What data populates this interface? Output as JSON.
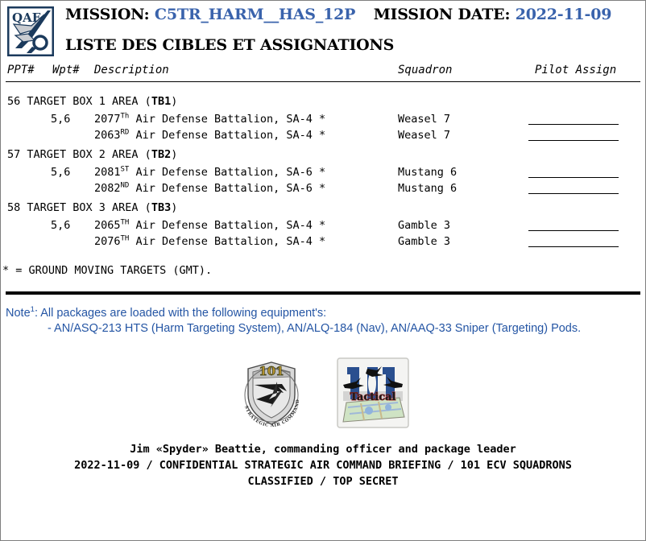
{
  "document": {
    "border_color": "#7f7f7f",
    "accent_blue": "#3a63ac",
    "note_blue": "#2455a4"
  },
  "header": {
    "logo_text": "QAF",
    "mission_label": "MISSION:",
    "mission_value": "C5TR_HARM__HAS_12P",
    "date_label": "MISSION DATE:",
    "date_value": "2022-11-09",
    "subtitle": "LISTE DES CIBLES ET ASSIGNATIONS"
  },
  "columns": {
    "ppt": "PPT#",
    "wpt": "Wpt#",
    "description": "Description",
    "squadron": "Squadron",
    "pilot_assign": "Pilot Assign"
  },
  "groups": [
    {
      "title_prefix": "56 TARGET BOX 1 AREA (",
      "title_code": "TB1",
      "title_suffix": ")",
      "rows": [
        {
          "wpt": "5,6",
          "unit_number": "2077",
          "unit_ordinal": "Th",
          "desc_rest": " Air Defense Battalion, SA-4 *",
          "squadron": "Weasel 7",
          "pilot_assign": ""
        },
        {
          "wpt": "",
          "unit_number": "2063",
          "unit_ordinal": "RD",
          "desc_rest": " Air Defense Battalion, SA-4 *",
          "squadron": "Weasel 7",
          "pilot_assign": ""
        }
      ]
    },
    {
      "title_prefix": "57 TARGET BOX 2 AREA (",
      "title_code": "TB2",
      "title_suffix": ")",
      "rows": [
        {
          "wpt": "5,6",
          "unit_number": "2081",
          "unit_ordinal": "ST",
          "desc_rest": " Air Defense Battalion, SA-6 *",
          "squadron": "Mustang 6",
          "pilot_assign": ""
        },
        {
          "wpt": "",
          "unit_number": "2082",
          "unit_ordinal": "ND",
          "desc_rest": " Air Defense Battalion, SA-6 *",
          "squadron": "Mustang 6",
          "pilot_assign": ""
        }
      ]
    },
    {
      "title_prefix": "58 TARGET BOX 3 AREA (",
      "title_code": "TB3",
      "title_suffix": ")",
      "rows": [
        {
          "wpt": "5,6",
          "unit_number": "2065",
          "unit_ordinal": "TH",
          "desc_rest": " Air Defense Battalion, SA-4 *",
          "squadron": "Gamble 3",
          "pilot_assign": ""
        },
        {
          "wpt": "",
          "unit_number": "2076",
          "unit_ordinal": "TH",
          "desc_rest": " Air Defense Battalion, SA-4 *",
          "squadron": "Gamble 3",
          "pilot_assign": ""
        }
      ]
    }
  ],
  "legend": {
    "gmt": "* = GROUND MOVING TARGETS (GMT)."
  },
  "note": {
    "label": "Note",
    "superscript": "1",
    "line1": ": All packages are loaded with the following equipment's:",
    "line2": "- AN/ASQ-213 HTS (Harm Targeting System), AN/ALQ-184 (Nav), AN/AAQ-33 Sniper (Targeting) Pods."
  },
  "emblems": {
    "sac": {
      "number": "101",
      "band_text": "STRATEGIC AIR COMMAND"
    },
    "tactical": {
      "number": "101",
      "word": "Tactical"
    }
  },
  "footer": {
    "line1": "Jim «Spyder» Beattie, commanding officer and package leader",
    "line2": "2022-11-09 / CONFIDENTIAL STRATEGIC AIR COMMAND BRIEFING / 101 ECV SQUADRONS",
    "line3": "CLASSIFIED / TOP SECRET"
  }
}
